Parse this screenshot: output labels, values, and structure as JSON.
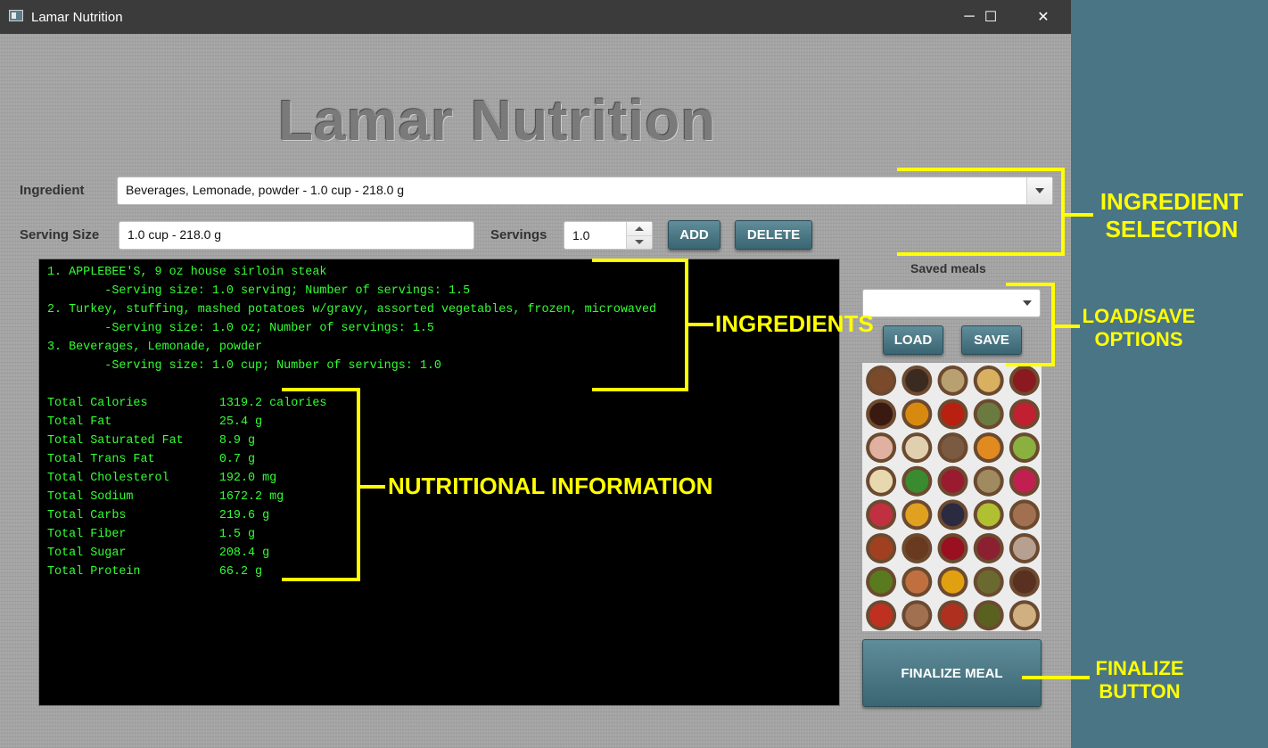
{
  "window": {
    "title": "Lamar Nutrition",
    "minimize": "─",
    "maximize": "☐",
    "close": "✕"
  },
  "heading": "Lamar Nutrition",
  "ingredient": {
    "label": "Ingredient",
    "selected": "Beverages, Lemonade, powder - 1.0 cup - 218.0 g"
  },
  "serving": {
    "label": "Serving Size",
    "value": "1.0 cup - 218.0 g",
    "servings_label": "Servings",
    "servings_value": "1.0"
  },
  "buttons": {
    "add": "ADD",
    "delete": "DELETE",
    "load": "LOAD",
    "save": "SAVE",
    "finalize": "FINALIZE MEAL"
  },
  "saved_meals": {
    "label": "Saved meals",
    "selected": ""
  },
  "console": {
    "lines": [
      "1. APPLEBEE'S, 9 oz house sirloin steak",
      "        -Serving size: 1.0 serving; Number of servings: 1.5",
      "2. Turkey, stuffing, mashed potatoes w/gravy, assorted vegetables, frozen, microwaved",
      "        -Serving size: 1.0 oz; Number of servings: 1.5",
      "3. Beverages, Lemonade, powder",
      "        -Serving size: 1.0 cup; Number of servings: 1.0",
      "",
      "Total Calories          1319.2 calories",
      "Total Fat               25.4 g",
      "Total Saturated Fat     8.9 g",
      "Total Trans Fat         0.7 g",
      "Total Cholesterol       192.0 mg",
      "Total Sodium            1672.2 mg",
      "Total Carbs             219.6 g",
      "Total Fiber             1.5 g",
      "Total Sugar             208.4 g",
      "Total Protein           66.2 g"
    ]
  },
  "annotations": {
    "ingredient_selection_1": "INGREDIENT",
    "ingredient_selection_2": "SELECTION",
    "ingredients": "INGREDIENTS",
    "load_save_1": "LOAD/SAVE",
    "load_save_2": "OPTIONS",
    "nutritional": "NUTRITIONAL INFORMATION",
    "finalize_1": "FINALIZE",
    "finalize_2": "BUTTON"
  },
  "colors": {
    "console_text": "#33ff33",
    "annotation": "#ffff00",
    "button": "#4a7584"
  },
  "food_bowls": [
    "#7a4a2a",
    "#3a2a20",
    "#b8a070",
    "#d8b060",
    "#8a1a20",
    "#3a1a10",
    "#d88a10",
    "#b82010",
    "#6a7a40",
    "#c02030",
    "#e0b0a0",
    "#e0d0b0",
    "#7a5a40",
    "#e08a20",
    "#8ab040",
    "#e8d8b0",
    "#3a8a30",
    "#9a1a30",
    "#a08a60",
    "#c02050",
    "#c03040",
    "#e0a020",
    "#2a2a40",
    "#b0c030",
    "#a07050",
    "#a04020",
    "#6a3a20",
    "#9a1020",
    "#8a2030",
    "#b8a090",
    "#5a7a20",
    "#c07040",
    "#e0a010",
    "#6a6a30",
    "#5a3020",
    "#c03020",
    "#a07050",
    "#b03020",
    "#5a6020",
    "#d0b080"
  ]
}
